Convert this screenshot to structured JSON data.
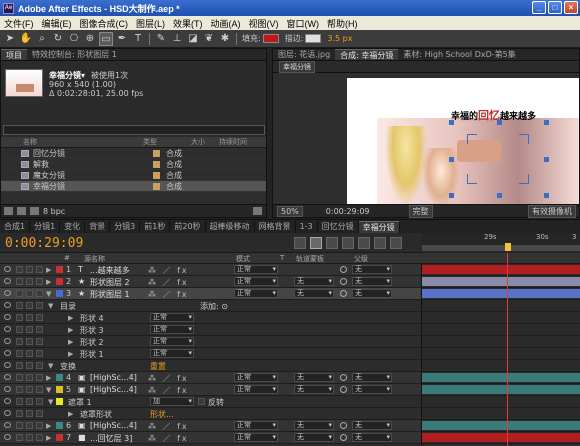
{
  "window": {
    "title": "Adobe After Effects - HSD大制作.aep *",
    "app_icon": "Ae",
    "min": "_",
    "max": "□",
    "close": "×"
  },
  "menu": [
    "文件(F)",
    "编辑(E)",
    "图像合成(C)",
    "图层(L)",
    "效果(T)",
    "动画(A)",
    "视图(V)",
    "窗口(W)",
    "帮助(H)"
  ],
  "toolbar": {
    "fill_label": "填充:",
    "stroke_label": "描边:",
    "stroke_width": "3.5 px",
    "fill_color": "#c01818",
    "stroke_color": "#e0e0e0"
  },
  "project": {
    "tabs": [
      "项目",
      "特效控制台: 形状图层 1"
    ],
    "selected_name": "幸福分镜▾",
    "used": "被使用1次",
    "dims": "960 x 540 (1.00)",
    "duration": "Δ 0:02:28:01, 25.00 fps",
    "cols": [
      "名称",
      "类型",
      "大小",
      "持续时间"
    ],
    "items": [
      {
        "name": "回忆分镜",
        "type": "合成",
        "color": "#c8a060"
      },
      {
        "name": "解救",
        "type": "合成",
        "color": "#c8a060"
      },
      {
        "name": "魔女分镜",
        "type": "合成",
        "color": "#c8a060"
      },
      {
        "name": "幸福分镜",
        "type": "合成",
        "color": "#c8a060",
        "sel": true
      }
    ],
    "bpc": "8 bpc"
  },
  "viewer": {
    "tabs": [
      "图层: 花语.jpg",
      "合成: 幸福分镜",
      "素材: High School DxD-第5集"
    ],
    "comp_dd": "幸福分镜",
    "caption_pre": "幸福的",
    "caption_hl": "回忆",
    "caption_post": "越来越多",
    "zoom": "50%",
    "time": "0:00:29:09",
    "res": "完整",
    "camera": "有效摄像机"
  },
  "timeline_tabs": [
    "合成1",
    "分镜1",
    "变化",
    "背景",
    "分镜3",
    "前1秒",
    "前20秒",
    "超棒级移动",
    "网格背景",
    "1-3",
    "回忆分镜",
    "幸福分镜"
  ],
  "timeline": {
    "timecode": "0:00:29:09",
    "ruler": [
      "29s",
      "30s",
      "3"
    ],
    "cols": {
      "num": "#",
      "name": "源名称",
      "mode": "模式",
      "t": "T",
      "trk": "轨道蒙板",
      "parent": "父级"
    }
  },
  "layers": [
    {
      "kind": "layer",
      "num": "1",
      "name": "...越来越多",
      "color": "#c83030",
      "mode": "正常",
      "trk": "",
      "parent": "无",
      "icon": "T",
      "bar": "#b02020"
    },
    {
      "kind": "layer",
      "num": "2",
      "name": "形状图层 2",
      "color": "#c83030",
      "mode": "正常",
      "trk": "无",
      "parent": "无",
      "icon": "★",
      "bar": "#8a8aaa"
    },
    {
      "kind": "layer",
      "num": "3",
      "name": "形状图层 1",
      "color": "#4a6ad8",
      "mode": "正常",
      "trk": "无",
      "parent": "无",
      "icon": "★",
      "bar": "#5a72c8",
      "sel": true,
      "open": true
    },
    {
      "kind": "prop",
      "indent": 1,
      "name": "目录",
      "add": "添加: ⊙"
    },
    {
      "kind": "prop",
      "indent": 2,
      "name": "形状 4",
      "mode": "正常"
    },
    {
      "kind": "prop",
      "indent": 2,
      "name": "形状 3",
      "mode": "正常"
    },
    {
      "kind": "prop",
      "indent": 2,
      "name": "形状 2",
      "mode": "正常"
    },
    {
      "kind": "prop",
      "indent": 2,
      "name": "形状 1",
      "mode": "正常"
    },
    {
      "kind": "prop",
      "indent": 1,
      "name": "变换",
      "val": "重置"
    },
    {
      "kind": "layer",
      "num": "4",
      "name": "[HighSc...4]",
      "color": "#3a8a8a",
      "mode": "正常",
      "trk": "无",
      "parent": "无",
      "icon": "▣",
      "bar": "#3a7a78"
    },
    {
      "kind": "layer",
      "num": "5",
      "name": "[HighSc...4]",
      "color": "#d8c020",
      "mode": "正常",
      "trk": "无",
      "parent": "无",
      "icon": "▣",
      "bar": "#3a7a78",
      "open": true
    },
    {
      "kind": "prop",
      "indent": 1,
      "name": "遮罩 1",
      "mode": "加",
      "inv": "反转",
      "maskcolor": "#e8e820"
    },
    {
      "kind": "prop",
      "indent": 2,
      "name": "遮罩形状",
      "val": "形状..."
    },
    {
      "kind": "layer",
      "num": "6",
      "name": "[HighSc...4]",
      "color": "#3a8a8a",
      "mode": "正常",
      "trk": "无",
      "parent": "无",
      "icon": "▣",
      "bar": "#3a7a78"
    },
    {
      "kind": "layer",
      "num": "7",
      "name": "...回忆层 3]",
      "color": "#c83030",
      "mode": "正常",
      "trk": "无",
      "parent": "无",
      "icon": "■",
      "bar": "#b02020"
    }
  ]
}
